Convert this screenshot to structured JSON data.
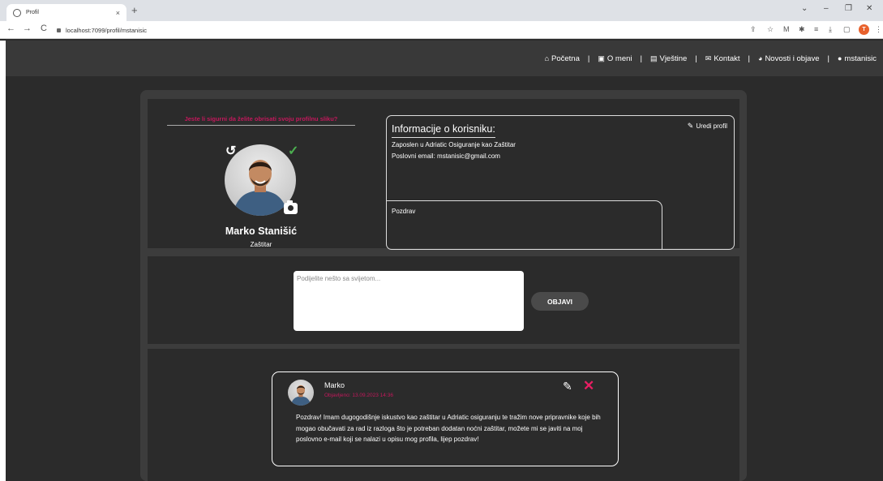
{
  "browser": {
    "tab_title": "Profil",
    "tab_close": "×",
    "new_tab": "+",
    "url": "localhost:7099/profil/mstanisic",
    "back": "←",
    "forward": "→",
    "reload": "C",
    "window_controls": [
      "⌄",
      "–",
      "❐",
      "✕"
    ],
    "extension_icons": [
      "⇪",
      "☆",
      "M",
      "✱",
      "≡",
      "⤓",
      "▢",
      "⋮"
    ],
    "profile_initial": "T"
  },
  "nav": {
    "items": [
      {
        "icon": "home-icon",
        "glyph": "⌂",
        "label": "Početna"
      },
      {
        "icon": "id-card-icon",
        "glyph": "▣",
        "label": "O meni"
      },
      {
        "icon": "document-icon",
        "glyph": "▤",
        "label": "Vještine"
      },
      {
        "icon": "envelope-icon",
        "glyph": "✉",
        "label": "Kontakt"
      },
      {
        "icon": "comments-icon",
        "glyph": "◕",
        "label": "Novosti i objave"
      },
      {
        "icon": "user-icon",
        "glyph": "●",
        "label": "mstanisic"
      }
    ],
    "separator": "|"
  },
  "profile": {
    "confirm_text": "Jeste li sigurni da želite obrisati svoju profilnu sliku?",
    "undo_glyph": "↺",
    "check_glyph": "✓",
    "name": "Marko Stanišić",
    "role": "Zaštitar"
  },
  "info": {
    "title": "Informacije o korisniku:",
    "edit_label": "Uredi profil",
    "edit_glyph": "✎",
    "line1": "Zaposlen u Adriatic Osiguranje kao Zaštitar",
    "line2": "Poslovni email: mstanisic@gmail.com",
    "bio": "Pozdrav"
  },
  "composer": {
    "placeholder": "Podijelite nešto sa svijetom...",
    "button": "OBJAVI"
  },
  "post": {
    "author": "Marko",
    "date": "Objavljeno: 13.09.2023 14:36",
    "edit_glyph": "✎",
    "delete_glyph": "✕",
    "body": "Pozdrav! Imam dugogodišnje iskustvo kao zaštitar u Adriatic osiguranju te tražim nove pripravnike koje bih mogao obučavati za rad iz razloga što je potreban dodatan noćni zaštitar, možete mi se javiti na moj poslovno e-mail koji se nalazi u opisu mog profila, lijep pozdrav!"
  },
  "colors": {
    "accent": "#c2185b",
    "delete": "#e91e63",
    "check": "#4caf50",
    "background": "#2b2b2b",
    "panel": "#3c3c3c",
    "nav": "#393939"
  }
}
